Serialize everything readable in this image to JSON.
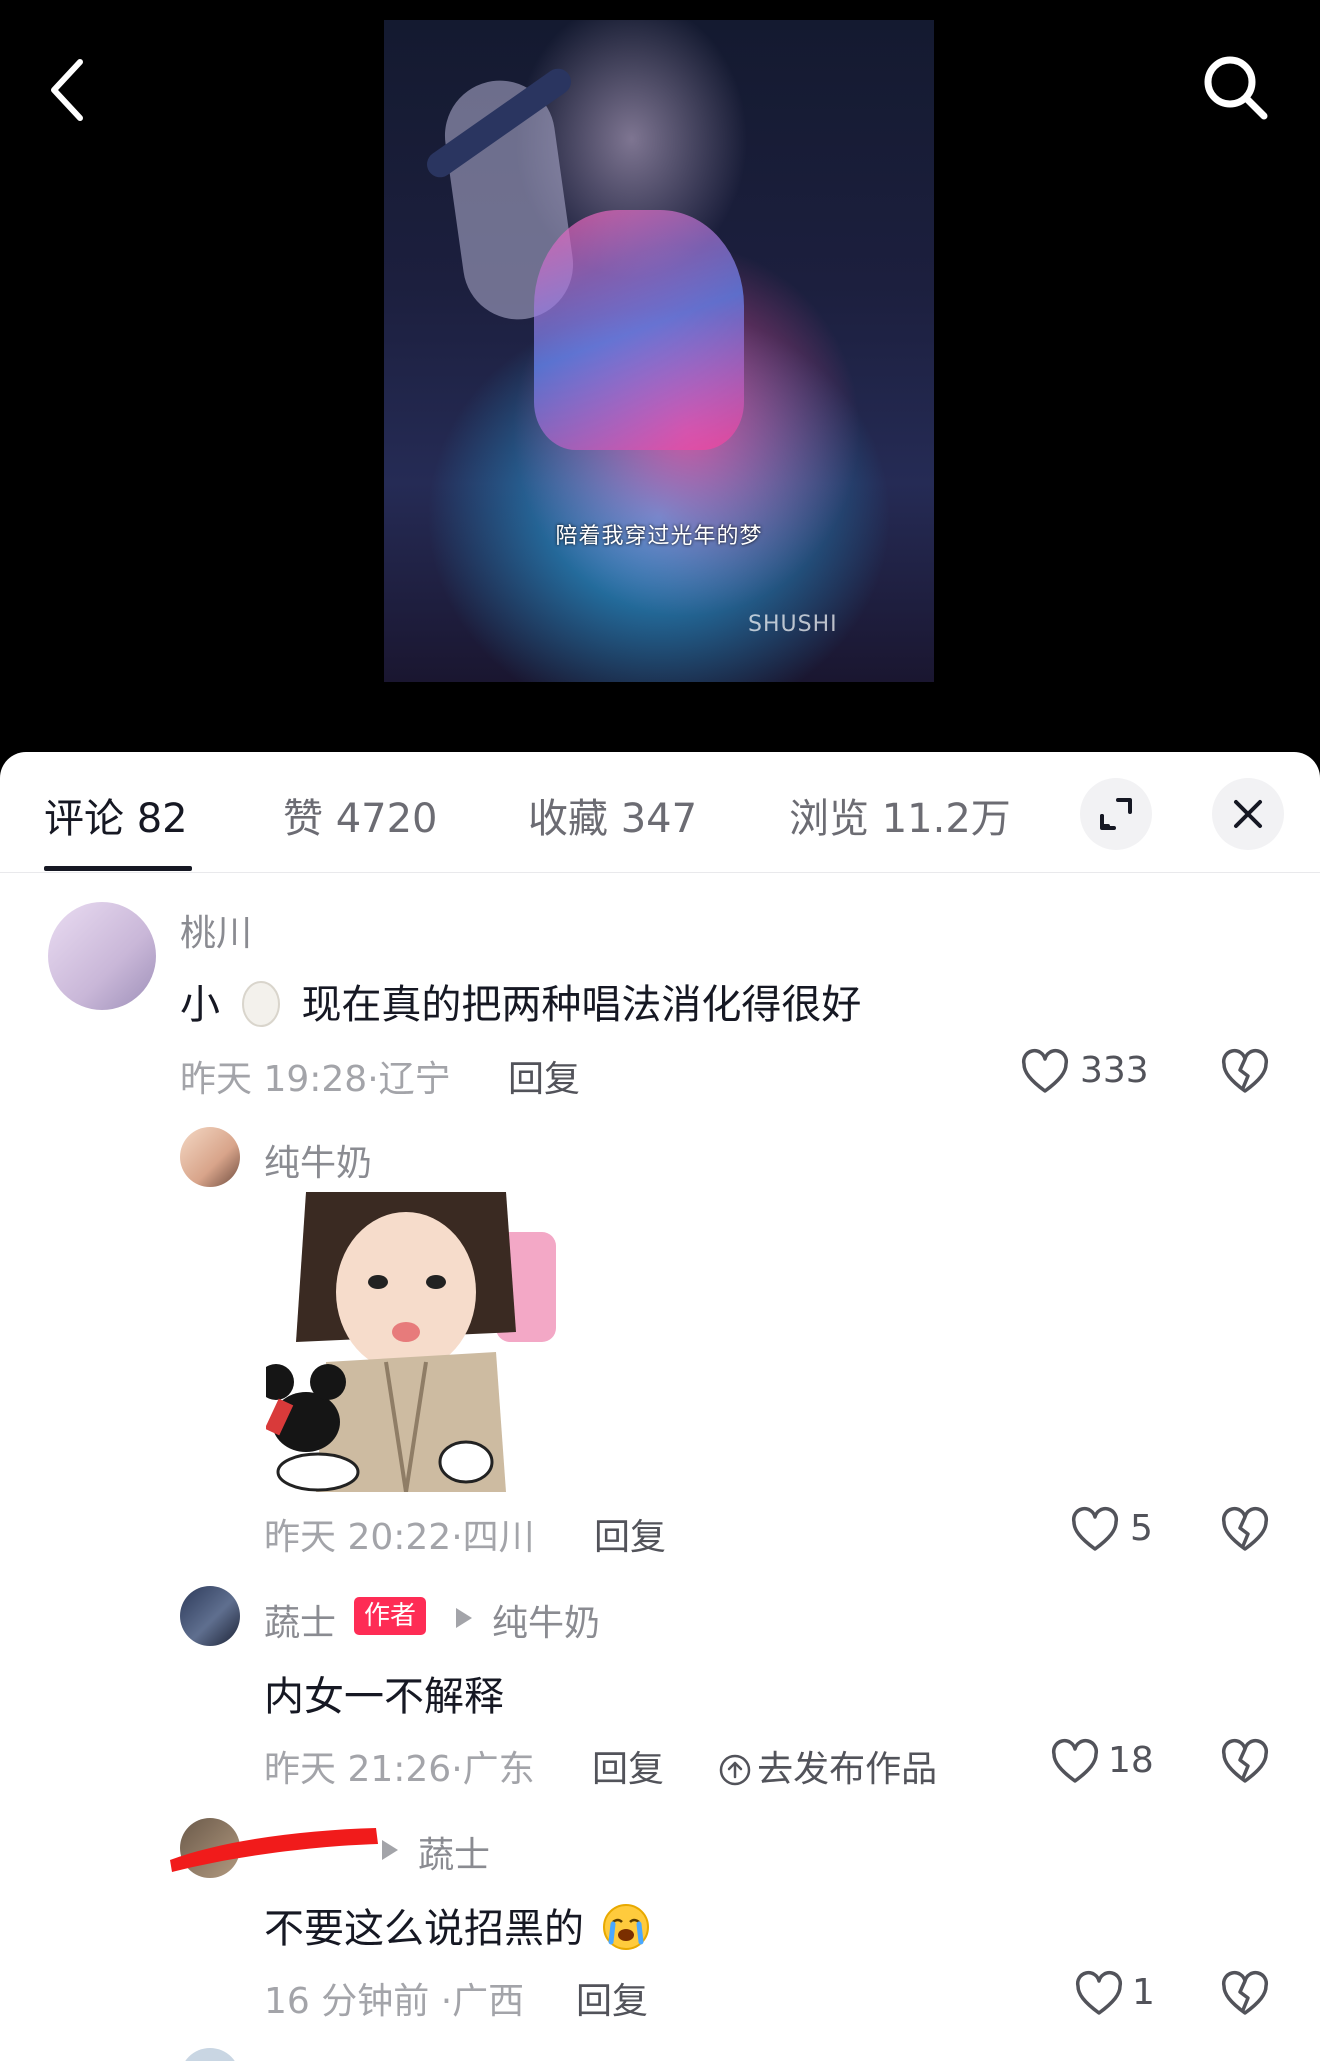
{
  "video": {
    "caption": "陪着我穿过光年的梦",
    "watermark": "SHUSHI"
  },
  "tabs": [
    {
      "label": "评论 82",
      "active": true
    },
    {
      "label": "赞 4720"
    },
    {
      "label": "收藏 347"
    },
    {
      "label": "浏览 11.2万"
    }
  ],
  "comments": [
    {
      "username": "桃川",
      "text": "小",
      "text_after": "现在真的把两种唱法消化得很好",
      "meta": "昨天 19:28·辽宁",
      "reply_label": "回复",
      "likes": "333"
    },
    {
      "username": "纯牛奶",
      "sticker_desc": "sticker",
      "meta": "昨天 20:22·四川",
      "reply_label": "回复",
      "likes": "5"
    },
    {
      "username": "蔬士",
      "badge": "作者",
      "reply_to": "纯牛奶",
      "text": "内女一不解释",
      "meta": "昨天 21:26·广东",
      "reply_label": "回复",
      "publish_label": "去发布作品",
      "likes": "18"
    },
    {
      "username": "",
      "reply_to": "蔬士",
      "text": "不要这么说招黑的",
      "meta": "16 分钟前 ·广西",
      "reply_label": "回复",
      "likes": "1"
    }
  ],
  "icons": {
    "back": "chevron-left-icon",
    "search": "search-icon",
    "expand": "expand-icon",
    "close": "close-icon",
    "like": "heart-icon",
    "dislike": "broken-heart-icon",
    "publish": "upload-circle-icon"
  },
  "colors": {
    "accent": "#fe2c55",
    "text_primary": "#161823",
    "text_secondary": "#a3a4a9"
  }
}
